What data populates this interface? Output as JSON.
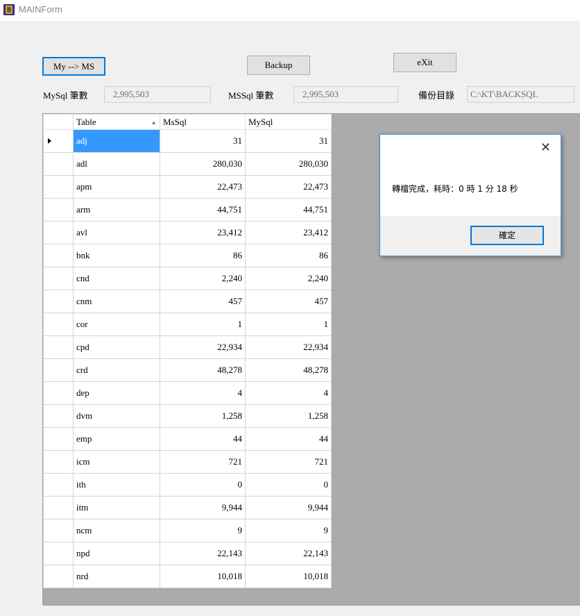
{
  "window": {
    "title": "MAINForm"
  },
  "toolbar": {
    "my_to_ms_label": "My --> MS",
    "backup_label": "Backup",
    "exit_label": "eXit"
  },
  "fields": {
    "mysql_count_label": "MySql 筆數",
    "mysql_count_value": "2,995,503",
    "mssql_count_label": "MSSql 筆數",
    "mssql_count_value": "2,995,503",
    "backup_dir_label": "備份目錄",
    "backup_dir_value": "C:\\KT\\BACKSQL"
  },
  "grid": {
    "columns": [
      "Table",
      "MsSql",
      "MySql"
    ],
    "sorted_column": "Table",
    "selected_row": 0,
    "rows": [
      {
        "table": "adj",
        "mssql": "31",
        "mysql": "31"
      },
      {
        "table": "adl",
        "mssql": "280,030",
        "mysql": "280,030"
      },
      {
        "table": "apm",
        "mssql": "22,473",
        "mysql": "22,473"
      },
      {
        "table": "arm",
        "mssql": "44,751",
        "mysql": "44,751"
      },
      {
        "table": "avl",
        "mssql": "23,412",
        "mysql": "23,412"
      },
      {
        "table": "bnk",
        "mssql": "86",
        "mysql": "86"
      },
      {
        "table": "cnd",
        "mssql": "2,240",
        "mysql": "2,240"
      },
      {
        "table": "cnm",
        "mssql": "457",
        "mysql": "457"
      },
      {
        "table": "cor",
        "mssql": "1",
        "mysql": "1"
      },
      {
        "table": "cpd",
        "mssql": "22,934",
        "mysql": "22,934"
      },
      {
        "table": "crd",
        "mssql": "48,278",
        "mysql": "48,278"
      },
      {
        "table": "dep",
        "mssql": "4",
        "mysql": "4"
      },
      {
        "table": "dvm",
        "mssql": "1,258",
        "mysql": "1,258"
      },
      {
        "table": "emp",
        "mssql": "44",
        "mysql": "44"
      },
      {
        "table": "icm",
        "mssql": "721",
        "mysql": "721"
      },
      {
        "table": "ith",
        "mssql": "0",
        "mysql": "0"
      },
      {
        "table": "itm",
        "mssql": "9,944",
        "mysql": "9,944"
      },
      {
        "table": "ncm",
        "mssql": "9",
        "mysql": "9"
      },
      {
        "table": "npd",
        "mssql": "22,143",
        "mysql": "22,143"
      },
      {
        "table": "nrd",
        "mssql": "10,018",
        "mysql": "10,018"
      }
    ]
  },
  "dialog": {
    "message": "轉檔完成，耗時：0 時 1 分 18 秒",
    "ok_label": "確定"
  },
  "colors": {
    "window_bg": "#f0f0f0",
    "accent": "#0078d7",
    "selection": "#3399ff",
    "grid_bg": "#ababab"
  }
}
